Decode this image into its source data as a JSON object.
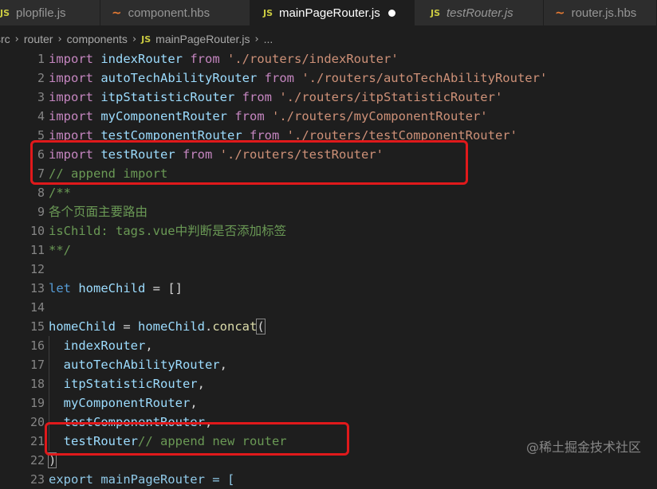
{
  "tabs": [
    {
      "label": "plopfile.js",
      "icon": "js",
      "active": false,
      "italic": false,
      "modified": false
    },
    {
      "label": "component.hbs",
      "icon": "hbs",
      "active": false,
      "italic": false,
      "modified": false
    },
    {
      "label": "mainPageRouter.js",
      "icon": "js",
      "active": true,
      "italic": false,
      "modified": true
    },
    {
      "label": "testRouter.js",
      "icon": "js",
      "active": false,
      "italic": true,
      "modified": false
    },
    {
      "label": "router.js.hbs",
      "icon": "hbs",
      "active": false,
      "italic": false,
      "modified": false
    }
  ],
  "icons": {
    "js": "JS",
    "hbs": "~"
  },
  "breadcrumb": {
    "items": [
      "src",
      "router",
      "components"
    ],
    "file": "mainPageRouter.js",
    "more": "..."
  },
  "code": {
    "line_numbers": [
      "1",
      "2",
      "3",
      "4",
      "5",
      "6",
      "7",
      "8",
      "9",
      "10",
      "11",
      "12",
      "13",
      "14",
      "15",
      "16",
      "17",
      "18",
      "19",
      "20",
      "21",
      "22",
      "23"
    ],
    "l1": {
      "kw": "import",
      "id": "indexRouter",
      "from": "from",
      "str": "'./routers/indexRouter'"
    },
    "l2": {
      "kw": "import",
      "id": "autoTechAbilityRouter",
      "from": "from",
      "str": "'./routers/autoTechAbilityRouter'"
    },
    "l3": {
      "kw": "import",
      "id": "itpStatisticRouter",
      "from": "from",
      "str": "'./routers/itpStatisticRouter'"
    },
    "l4": {
      "kw": "import",
      "id": "myComponentRouter",
      "from": "from",
      "str": "'./routers/myComponentRouter'"
    },
    "l5": {
      "kw": "import",
      "id": "testComponentRouter",
      "from": "from",
      "str": "'./routers/testComponentRouter'"
    },
    "l6": {
      "kw": "import",
      "id": "testRouter",
      "from": "from",
      "str": "'./routers/testRouter'"
    },
    "l7": {
      "cmt": "// append import"
    },
    "l8": {
      "cmt": "/**"
    },
    "l9": {
      "cmt": "各个页面主要路由"
    },
    "l10": {
      "cmt": "isChild: tags.vue中判断是否添加标签"
    },
    "l11": {
      "cmt": "**/"
    },
    "l13": {
      "kw": "let",
      "id": "homeChild",
      "rest": " = []"
    },
    "l15": {
      "id": "homeChild",
      "eq": " = ",
      "obj": "homeChild",
      "dot": ".",
      "fn": "concat",
      "br": "("
    },
    "l16": {
      "id": "indexRouter",
      "punc": ","
    },
    "l17": {
      "id": "autoTechAbilityRouter",
      "punc": ","
    },
    "l18": {
      "id": "itpStatisticRouter",
      "punc": ","
    },
    "l19": {
      "id": "myComponentRouter",
      "punc": ","
    },
    "l20": {
      "id": "testComponentRouter",
      "punc": ","
    },
    "l21": {
      "id": "testRouter",
      "cmt": "// append new router"
    },
    "l22": {
      "br": ")"
    },
    "l23": {
      "partial": "export mainPageRouter = ["
    }
  },
  "watermark": "@稀土掘金技术社区",
  "colors": {
    "highlight": "#e0191b",
    "keyword": "#c586c0",
    "string": "#ce9178",
    "comment": "#6a9955",
    "identifier": "#9cdcfe"
  }
}
